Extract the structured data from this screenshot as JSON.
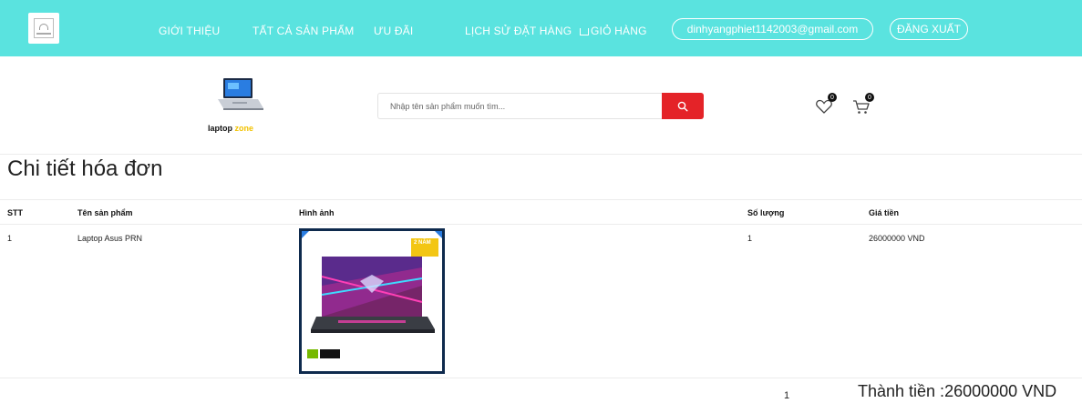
{
  "nav": {
    "items": [
      "GIỚI THIỆU",
      "TẤT CẢ SẢN PHẨM",
      "ƯU ĐÃI",
      "LỊCH SỬ ĐẶT HÀNG",
      "GIỎ HÀNG"
    ],
    "email": "dinhyangphiet1142003@gmail.com",
    "logout": "ĐĂNG XUẤT"
  },
  "brand": {
    "name_part1": "laptop ",
    "name_part2": "zone"
  },
  "search": {
    "placeholder": "Nhập tên sản phẩm muốn tìm..."
  },
  "header_icons": {
    "wishlist_count": "0",
    "cart_count": "0"
  },
  "page": {
    "title": "Chi tiết hóa đơn"
  },
  "table": {
    "headers": [
      "STT",
      "Tên sản phẩm",
      "Hình ảnh",
      "Số lượng",
      "Giá tiền"
    ],
    "rows": [
      {
        "stt": "1",
        "name": "Laptop Asus PRN",
        "quantity": "1",
        "price": "26000000 VND",
        "image_badge": "2 NĂM"
      }
    ]
  },
  "footer": {
    "total_quantity": "1",
    "total_label": "Thành tiền :26000000 VND"
  },
  "colors": {
    "topbar": "#5ae3df",
    "search_button": "#e42328",
    "image_frame": "#0e2a4d"
  }
}
